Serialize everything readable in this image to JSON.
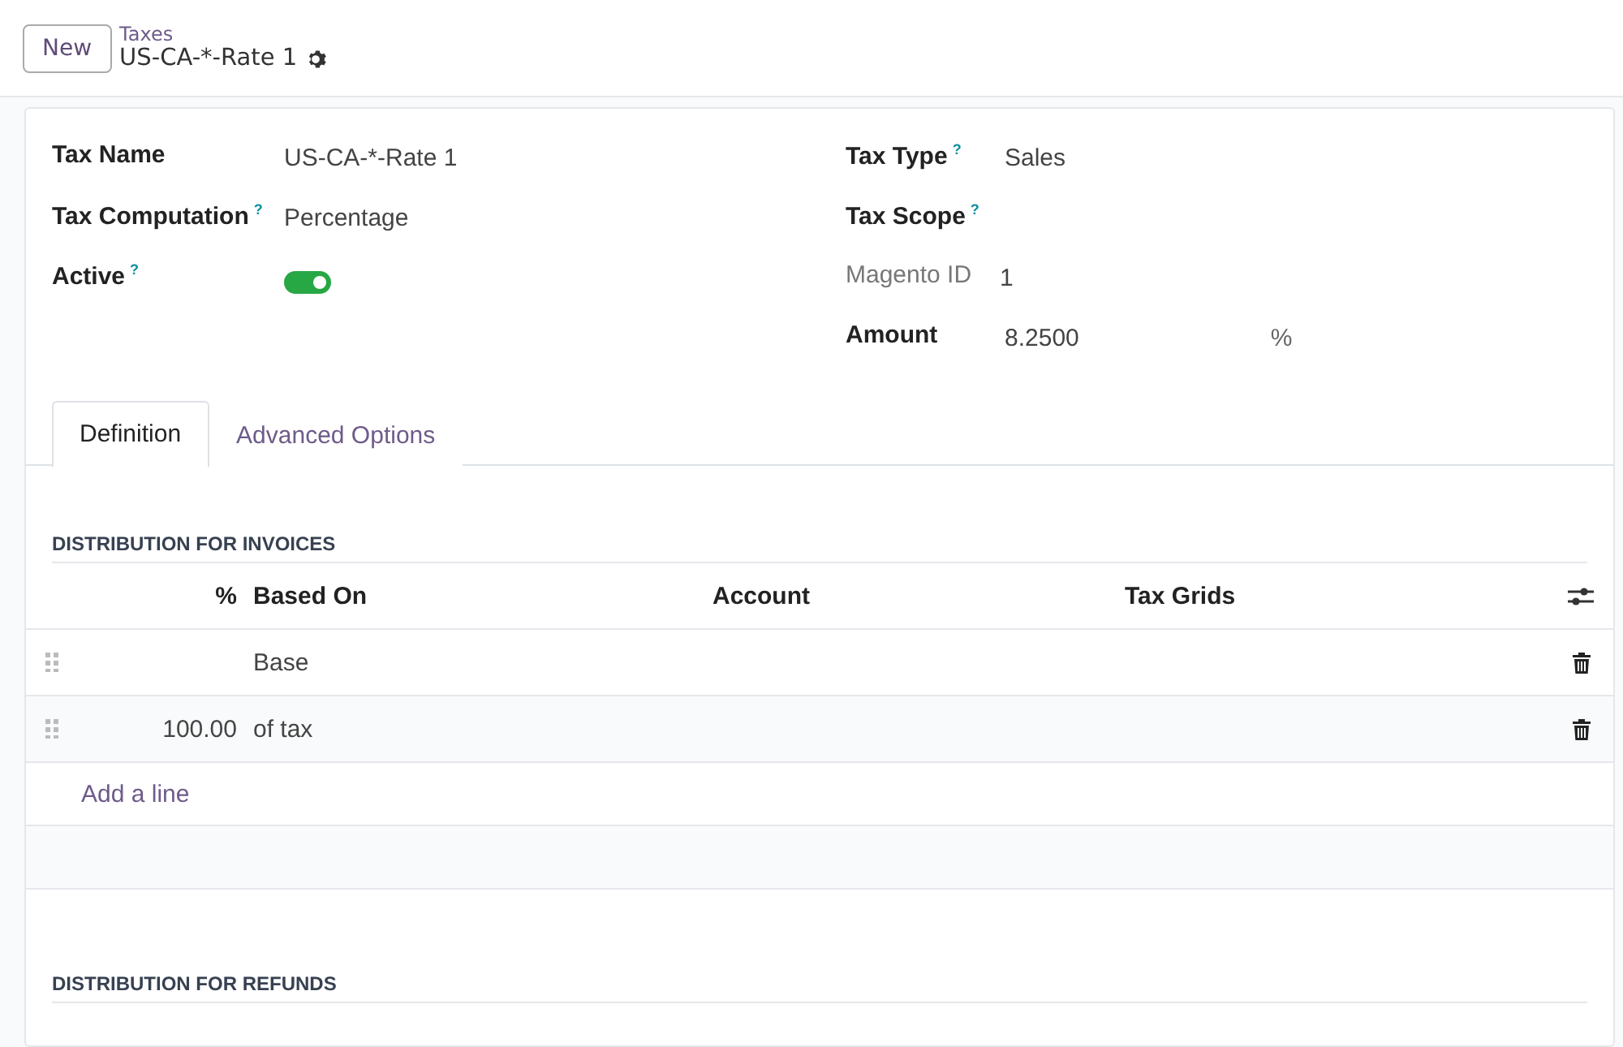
{
  "control_panel": {
    "new_button": "New",
    "breadcrumb": "Taxes",
    "record_title": "US-CA-*-Rate 1"
  },
  "left_fields": [
    {
      "kind": "text",
      "label": "Tax Name",
      "value": "US-CA-*-Rate 1"
    },
    {
      "kind": "text",
      "label": "Tax Computation",
      "help": "?",
      "value": "Percentage"
    },
    {
      "kind": "toggle",
      "label": "Active",
      "help": "?",
      "on": true
    }
  ],
  "right_fields": [
    {
      "kind": "text",
      "label": "Tax Type",
      "help": "?",
      "value": "Sales",
      "muted": false
    },
    {
      "kind": "text",
      "label": "Tax Scope",
      "help": "?",
      "muted": false
    },
    {
      "kind": "text",
      "label": "Magento ID",
      "value": "1",
      "muted": true
    },
    {
      "kind": "amount",
      "label": "Amount",
      "value": "8.2500",
      "unit": "%",
      "muted": false
    }
  ],
  "tabs": [
    {
      "label": "Definition",
      "selected": true
    },
    {
      "label": "Advanced Options",
      "selected": false
    }
  ],
  "invoices": {
    "title": "DISTRIBUTION FOR INVOICES",
    "columns": [
      "%",
      "Based On",
      "Account",
      "Tax Grids"
    ],
    "rows": [
      {
        "based_on": "Base"
      },
      {
        "percent": "100.00",
        "based_on": "of tax"
      }
    ],
    "add_line": "Add a line"
  },
  "refunds": {
    "title": "DISTRIBUTION FOR REFUNDS"
  }
}
